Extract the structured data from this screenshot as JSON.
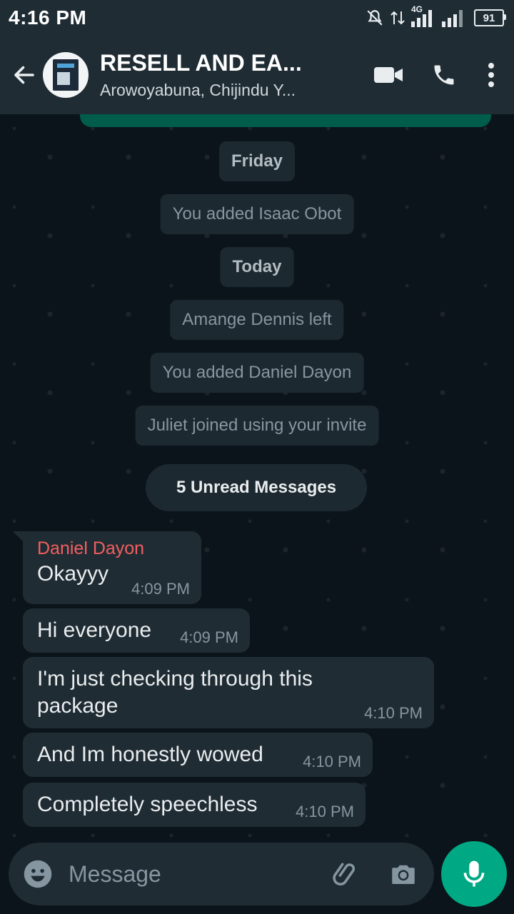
{
  "status_bar": {
    "time": "4:16 PM",
    "network_label": "4G",
    "battery": "91"
  },
  "header": {
    "title": "RESELL AND EA...",
    "subtitle": "Arowoyabuna, Chijindu Y..."
  },
  "system_messages": [
    {
      "text": "Friday",
      "kind": "date"
    },
    {
      "text": "You added Isaac Obot",
      "kind": "event"
    },
    {
      "text": "Today",
      "kind": "date"
    },
    {
      "text": "Amange Dennis left",
      "kind": "event"
    },
    {
      "text": "You added Daniel Dayon",
      "kind": "event"
    },
    {
      "text": "Juliet joined using your invite",
      "kind": "event"
    }
  ],
  "unread_label": "5 Unread Messages",
  "messages": [
    {
      "sender": "Daniel Dayon",
      "text": "Okayyy",
      "time": "4:09 PM"
    },
    {
      "text": "Hi everyone",
      "time": "4:09 PM"
    },
    {
      "text": "I'm just checking through this package",
      "time": "4:10 PM"
    },
    {
      "text": "And Im honestly wowed",
      "time": "4:10 PM"
    },
    {
      "text": "Completely speechless",
      "time": "4:10 PM"
    }
  ],
  "composer": {
    "placeholder": "Message"
  },
  "colors": {
    "header_bg": "#1f2c34",
    "chat_bg": "#0b141a",
    "bubble_bg": "#202c33",
    "accent": "#00a884",
    "sender_name": "#f25f5f"
  }
}
